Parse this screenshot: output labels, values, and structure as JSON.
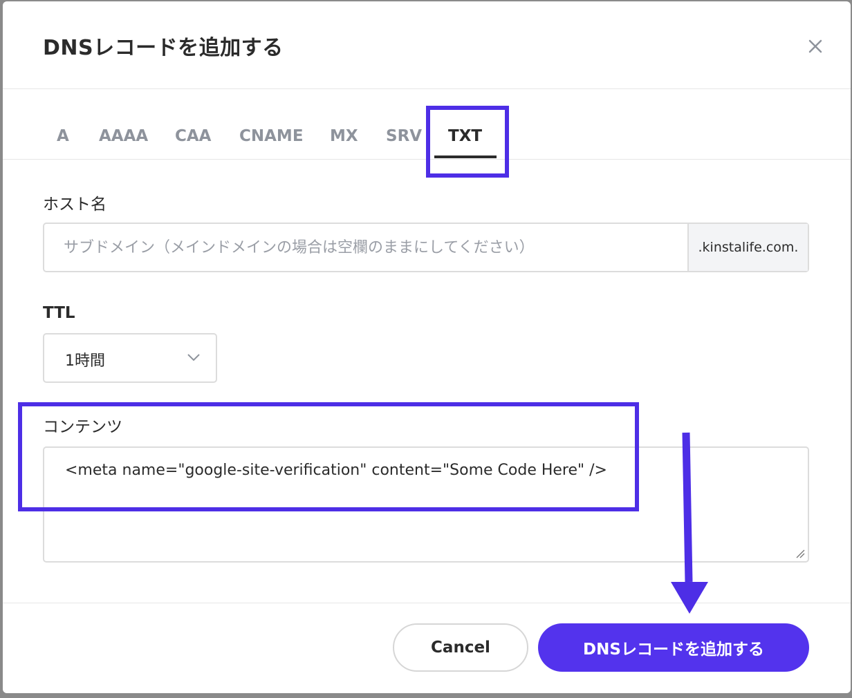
{
  "dialog": {
    "title": "DNSレコードを追加する",
    "close_label": "X"
  },
  "tabs": [
    {
      "label": "A",
      "active": false
    },
    {
      "label": "AAAA",
      "active": false
    },
    {
      "label": "CAA",
      "active": false
    },
    {
      "label": "CNAME",
      "active": false
    },
    {
      "label": "MX",
      "active": false
    },
    {
      "label": "SRV",
      "active": false
    },
    {
      "label": "TXT",
      "active": true
    }
  ],
  "hostname": {
    "label": "ホスト名",
    "placeholder": "サブドメイン（メインドメインの場合は空欄のままにしてください）",
    "value": "",
    "suffix": ".kinstalife.com."
  },
  "ttl": {
    "label": "TTL",
    "selected": "1時間"
  },
  "content": {
    "label": "コンテンツ",
    "value": "<meta name=\"google-site-verification\" content=\"Some Code Here\" />"
  },
  "buttons": {
    "cancel": "Cancel",
    "submit": "DNSレコードを追加する"
  },
  "colors": {
    "accent": "#5333ed",
    "highlight": "#4d2ee6",
    "text": "#2b2b2b",
    "muted": "#8e939c"
  },
  "icons": {
    "close": "close-icon",
    "chevron": "chevron-down-icon",
    "resize": "resize-handle-icon",
    "arrow": "arrow-down-annotation"
  }
}
